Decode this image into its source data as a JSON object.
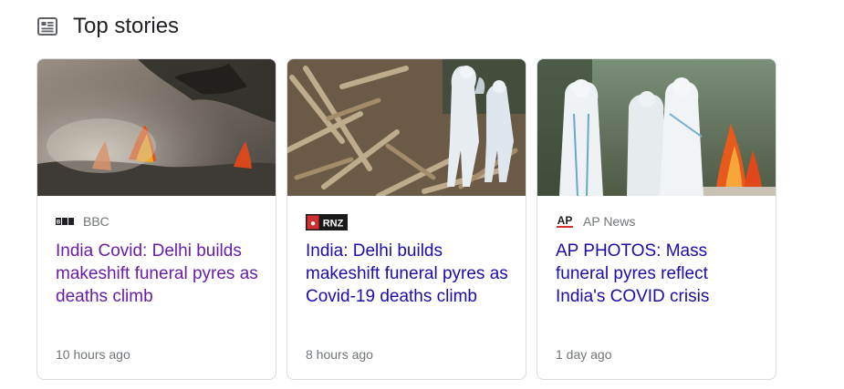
{
  "section": {
    "title": "Top stories",
    "icon": "newspaper-icon"
  },
  "colors": {
    "link": "#1a0dab",
    "visited_link": "#681da8",
    "meta_text": "#70757a",
    "border": "#dadce0"
  },
  "stories": [
    {
      "source": "BBC",
      "source_logo": "BBC",
      "headline": "India Covid: Delhi builds makeshift funeral pyres as deaths climb",
      "time": "10 hours ago",
      "visited": true
    },
    {
      "source_logo": "RNZ",
      "headline": "India: Delhi builds makeshift funeral pyres as Covid-19 deaths climb",
      "time": "8 hours ago",
      "visited": false
    },
    {
      "source": "AP News",
      "source_logo": "AP",
      "headline": "AP PHOTOS: Mass funeral pyres reflect India's COVID crisis",
      "time": "1 day ago",
      "visited": false
    }
  ]
}
